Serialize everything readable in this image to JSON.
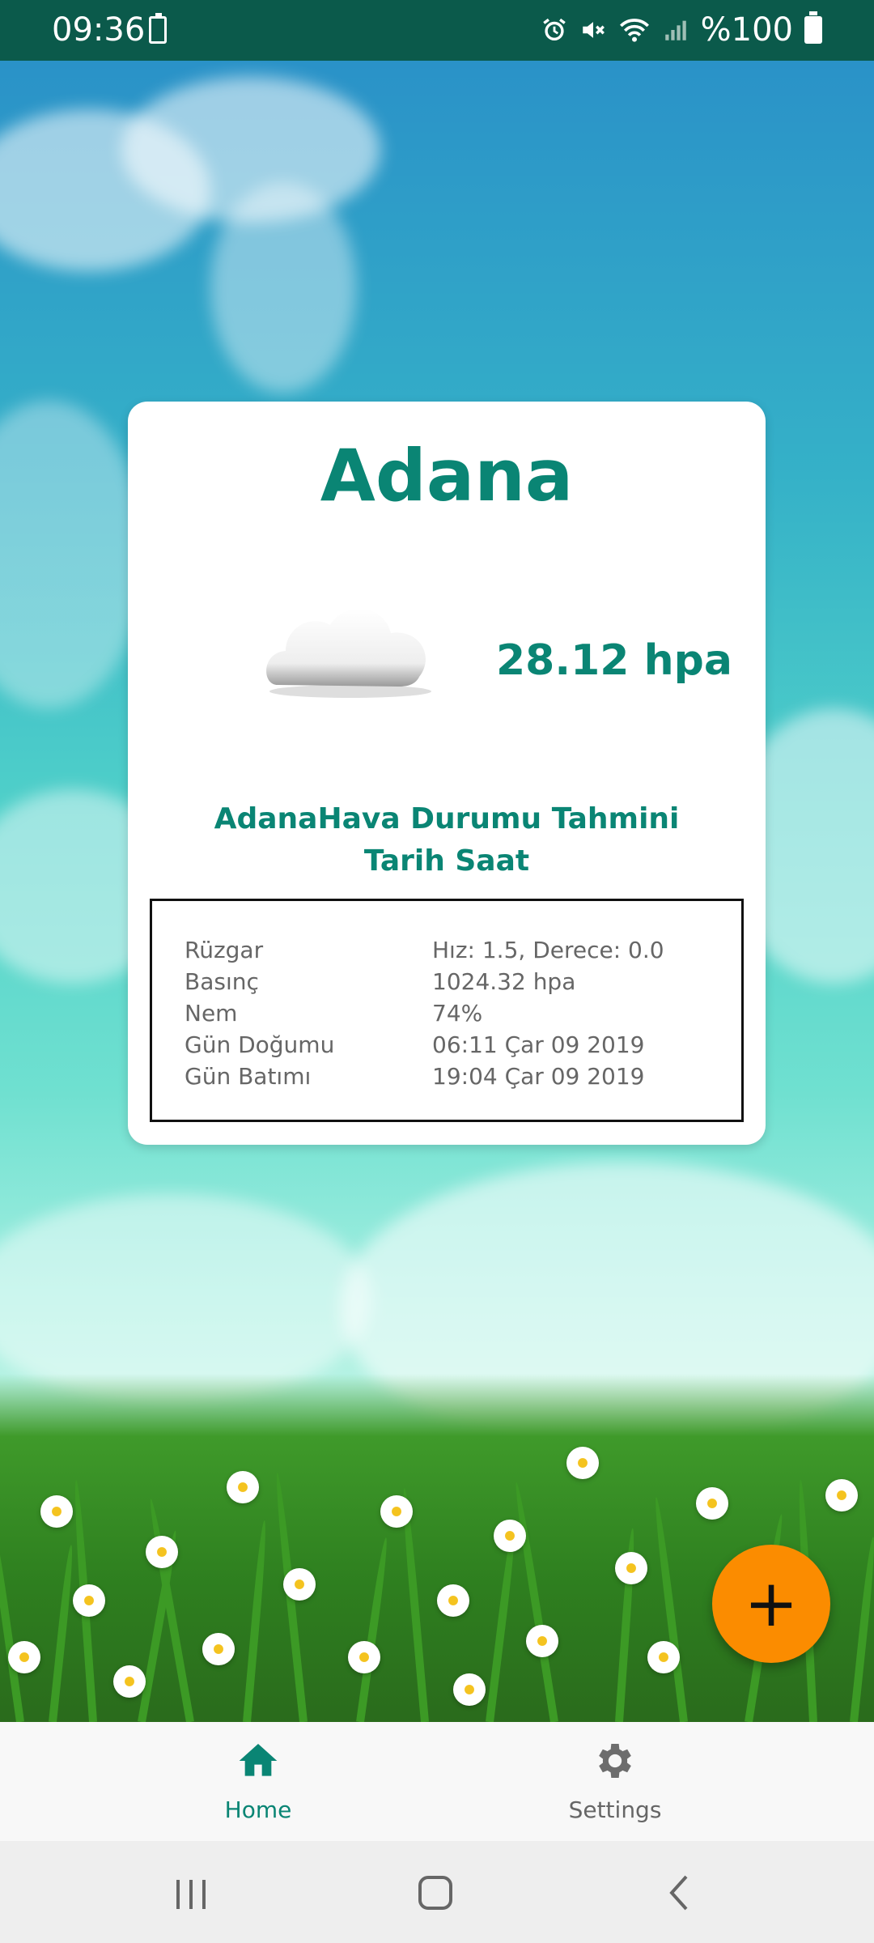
{
  "status_bar": {
    "time": "09:36",
    "battery_percent": "%100"
  },
  "card": {
    "city": "Adana",
    "pressure": "28.12 hpa",
    "forecast_title_line1": "AdanaHava Durumu Tahmini",
    "forecast_title_line2": "Tarih Saat",
    "details": [
      {
        "label": "Rüzgar",
        "value": "Hız: 1.5, Derece: 0.0"
      },
      {
        "label": "Basınç",
        "value": "1024.32 hpa"
      },
      {
        "label": "Nem",
        "value": "74%"
      },
      {
        "label": "Gün Doğumu",
        "value": "06:11 Çar 09 2019"
      },
      {
        "label": "Gün Batımı",
        "value": "19:04 Çar 09 2019"
      }
    ]
  },
  "fab": {
    "label": "+"
  },
  "bottom_nav": {
    "items": [
      {
        "label": "Home",
        "icon": "home-icon",
        "active": true
      },
      {
        "label": "Settings",
        "icon": "gear-icon",
        "active": false
      }
    ]
  },
  "colors": {
    "accent": "#0a8574",
    "fab": "#fb8c00",
    "status_bar": "#0b5a4b"
  }
}
